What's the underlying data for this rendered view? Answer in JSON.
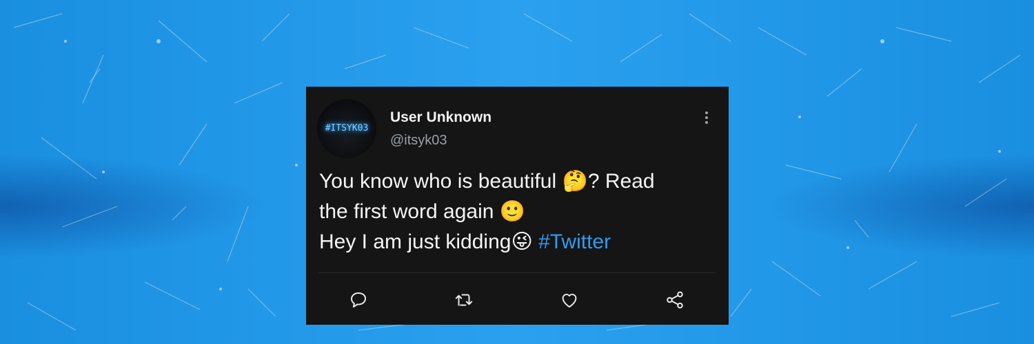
{
  "tweet": {
    "avatar_text": "#ITSYK03",
    "name": "User Unknown",
    "handle": "@itsyk03",
    "line1_text": "You know who is beautiful ",
    "line1_emoji": "🤔",
    "line1_tail": "? Read",
    "line2_text": "the first word again ",
    "line2_emoji": "🙂",
    "line3_text": "Hey I am just kidding",
    "line3_emoji": "😜",
    "hashtag": "#Twitter"
  },
  "actions": [
    {
      "icon": "reply-icon"
    },
    {
      "icon": "retweet-icon"
    },
    {
      "icon": "like-icon"
    },
    {
      "icon": "share-icon"
    }
  ],
  "colors": {
    "background": "#1e97ea",
    "card": "#151515",
    "hashtag": "#2f9bf0",
    "handle": "#9aa0a6"
  }
}
